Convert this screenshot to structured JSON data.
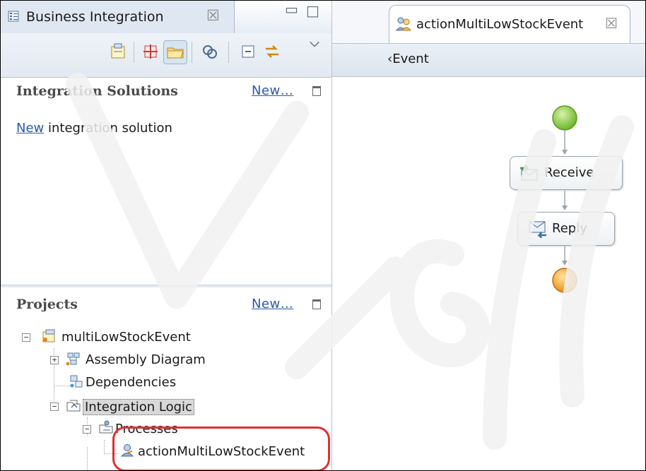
{
  "left_view": {
    "tab_title": "Business Integration",
    "tab_close": "☒",
    "minimize": "▭",
    "maximize": "□",
    "toolbar_icons": [
      "open-type-icon",
      "grid-icon",
      "folder-icon",
      "link-icon",
      "collapse-all-icon",
      "sync-icon",
      "view-menu-icon"
    ]
  },
  "solutions": {
    "title": "Integration Solutions",
    "new_link": "New…",
    "body_link": "New",
    "body_text": " integration solution"
  },
  "projects": {
    "title": "Projects",
    "new_link": "New…",
    "tree": {
      "root": "multiLowStockEvent",
      "assembly": "Assembly Diagram",
      "dependencies": "Dependencies",
      "integration_logic": "Integration Logic",
      "processes": "Processes",
      "process_item": "actionMultiLowStockEvent"
    }
  },
  "editor": {
    "tab_title": "actionMultiLowStockEvent",
    "tab_close": "☒",
    "breadcrumb": "‹Event",
    "activities": {
      "receive": "Receive",
      "reply": "Reply"
    }
  },
  "colors": {
    "start_node": "#7cc13a",
    "end_node": "#f0a020",
    "highlight": "#e03030",
    "link": "#2b5aa8"
  }
}
